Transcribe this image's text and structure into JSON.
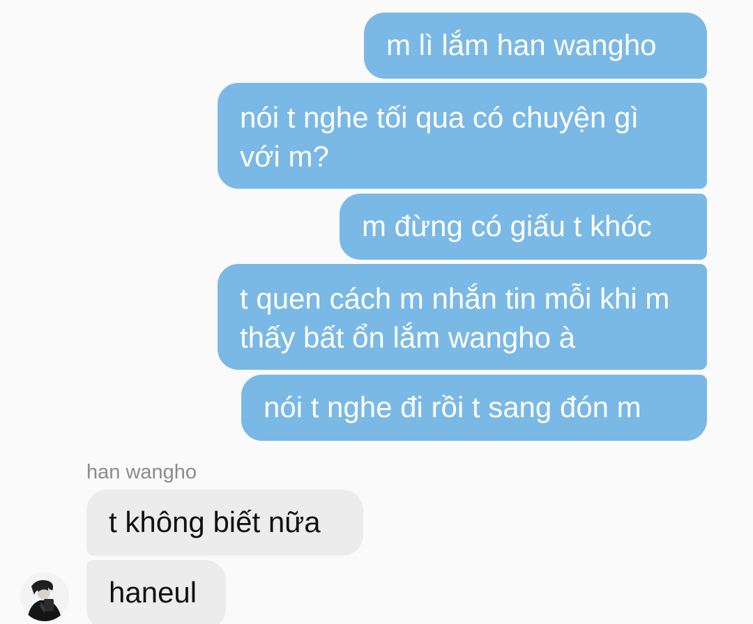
{
  "conversation": {
    "outgoing": [
      {
        "text": "m lì lắm han wangho"
      },
      {
        "text": "nói t nghe tối qua có chuyện gì với m?"
      },
      {
        "text": "m đừng có giấu t khóc"
      },
      {
        "text": "t quen cách m nhắn tin mỗi khi m thấy bất ổn lắm wangho à"
      },
      {
        "text": "nói t nghe đi rồi t sang đón m"
      }
    ],
    "incoming_sender": "han wangho",
    "incoming": [
      {
        "text": "t không biết nữa"
      },
      {
        "text": "haneul"
      }
    ]
  },
  "colors": {
    "background": "#fafafa",
    "outgoing_bubble": "#7ab9e5",
    "outgoing_text": "#ffffff",
    "incoming_bubble": "#ececec",
    "incoming_text": "#111111",
    "sender_name": "#8b8b8b"
  },
  "icons": {
    "avatar": "user-avatar-photo"
  }
}
